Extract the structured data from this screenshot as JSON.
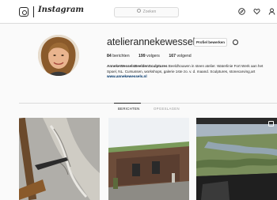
{
  "nav": {
    "logo_text": "Instagram",
    "search_placeholder": "Zoeken",
    "icons": [
      "camera-icon",
      "search-icon",
      "compass-icon",
      "heart-icon",
      "user-icon"
    ]
  },
  "profile": {
    "username": "atelierannekewessels",
    "edit_button": "Profiel bewerken",
    "stats": {
      "posts_count": "84",
      "posts_label": "berichten",
      "followers_count": "199",
      "followers_label": "volgers",
      "following_count": "167",
      "following_label": "volgend"
    },
    "bio_name": "AnnekeWesselsBeeldenSculptures",
    "bio_text": "Beeldhouwen in steen atelier. Waterlinie Fort Werk aan het Spoel, NL. Cursussen, workshops, galerie 1ste zo. v. d. maand. Sculptures, stonecarving,art",
    "website": "www.annekewessels.nl"
  },
  "tabs": [
    {
      "label": "BERICHTEN",
      "active": true
    },
    {
      "label": "OPGESLAGEN",
      "active": false
    }
  ],
  "colors": {
    "link": "#003569",
    "border": "#dbdbdb",
    "background": "#fafafa"
  }
}
